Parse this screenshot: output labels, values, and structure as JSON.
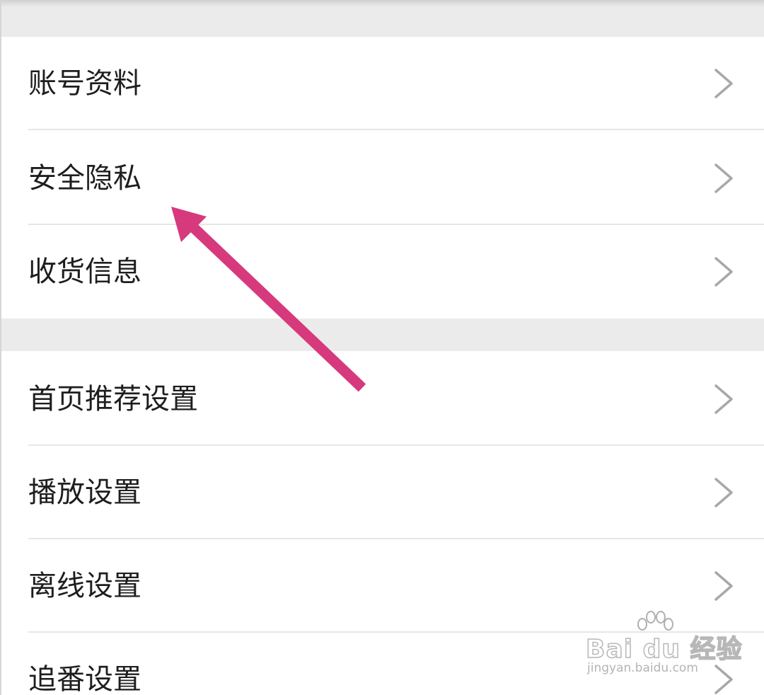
{
  "settings": {
    "groups": [
      {
        "items": [
          {
            "label": "账号资料",
            "icon": "chevron-right-icon"
          },
          {
            "label": "安全隐私",
            "icon": "chevron-right-icon"
          },
          {
            "label": "收货信息",
            "icon": "chevron-right-icon"
          }
        ]
      },
      {
        "items": [
          {
            "label": "首页推荐设置",
            "icon": "chevron-right-icon"
          },
          {
            "label": "播放设置",
            "icon": "chevron-right-icon"
          },
          {
            "label": "离线设置",
            "icon": "chevron-right-icon"
          },
          {
            "label": "追番设置",
            "icon": "chevron-right-icon"
          }
        ]
      }
    ]
  },
  "watermark": {
    "logo_text": "Bai du 经验",
    "url_text": "jingyan.baidu.com"
  },
  "colors": {
    "background": "#ffffff",
    "section_gap": "#ebebeb",
    "divider": "#e6e6e6",
    "label_text": "#1e1e1e",
    "chevron": "#a8a8a8",
    "annotation_arrow": "#d63a7c"
  }
}
